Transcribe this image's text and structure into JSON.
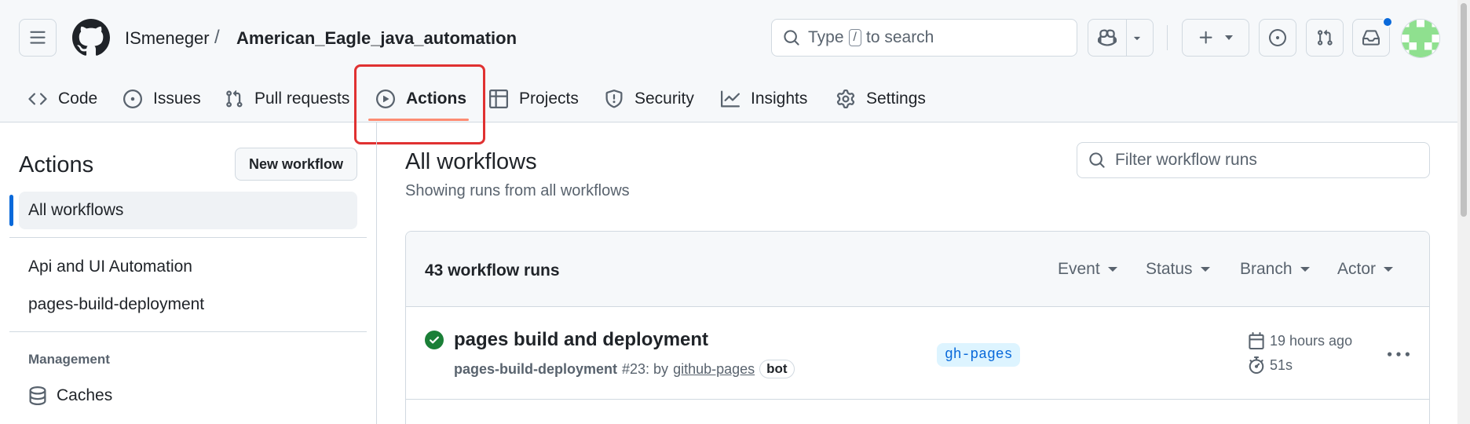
{
  "header": {
    "owner": "ISmeneger",
    "separator": "/",
    "repo": "American_Eagle_java_automation",
    "search": {
      "prefix": "Type",
      "key": "/",
      "suffix": "to search"
    }
  },
  "tabs": [
    {
      "label": "Code",
      "icon": "code-icon"
    },
    {
      "label": "Issues",
      "icon": "issue-icon"
    },
    {
      "label": "Pull requests",
      "icon": "pull-request-icon"
    },
    {
      "label": "Actions",
      "icon": "play-icon",
      "active": true
    },
    {
      "label": "Projects",
      "icon": "table-icon"
    },
    {
      "label": "Security",
      "icon": "shield-icon"
    },
    {
      "label": "Insights",
      "icon": "graph-icon"
    },
    {
      "label": "Settings",
      "icon": "gear-icon"
    }
  ],
  "sidebar": {
    "title": "Actions",
    "new_workflow": "New workflow",
    "all_workflows": "All workflows",
    "workflows": [
      "Api and UI Automation",
      "pages-build-deployment"
    ],
    "management_heading": "Management",
    "caches": "Caches"
  },
  "main": {
    "title": "All workflows",
    "subtitle": "Showing runs from all workflows",
    "filter_placeholder": "Filter workflow runs",
    "runs_count": "43 workflow runs",
    "filters": [
      "Event",
      "Status",
      "Branch",
      "Actor"
    ],
    "runs": [
      {
        "title": "pages build and deployment",
        "workflow": "pages-build-deployment",
        "run_number": "#23: by",
        "actor": "github-pages",
        "actor_badge": "bot",
        "branch": "gh-pages",
        "time": "19 hours ago",
        "duration": "51s",
        "status": "success"
      }
    ]
  },
  "colors": {
    "accent": "#0969da",
    "active_tab_underline": "#fd8c73",
    "highlight": "#e03131",
    "success": "#1a7f37"
  }
}
